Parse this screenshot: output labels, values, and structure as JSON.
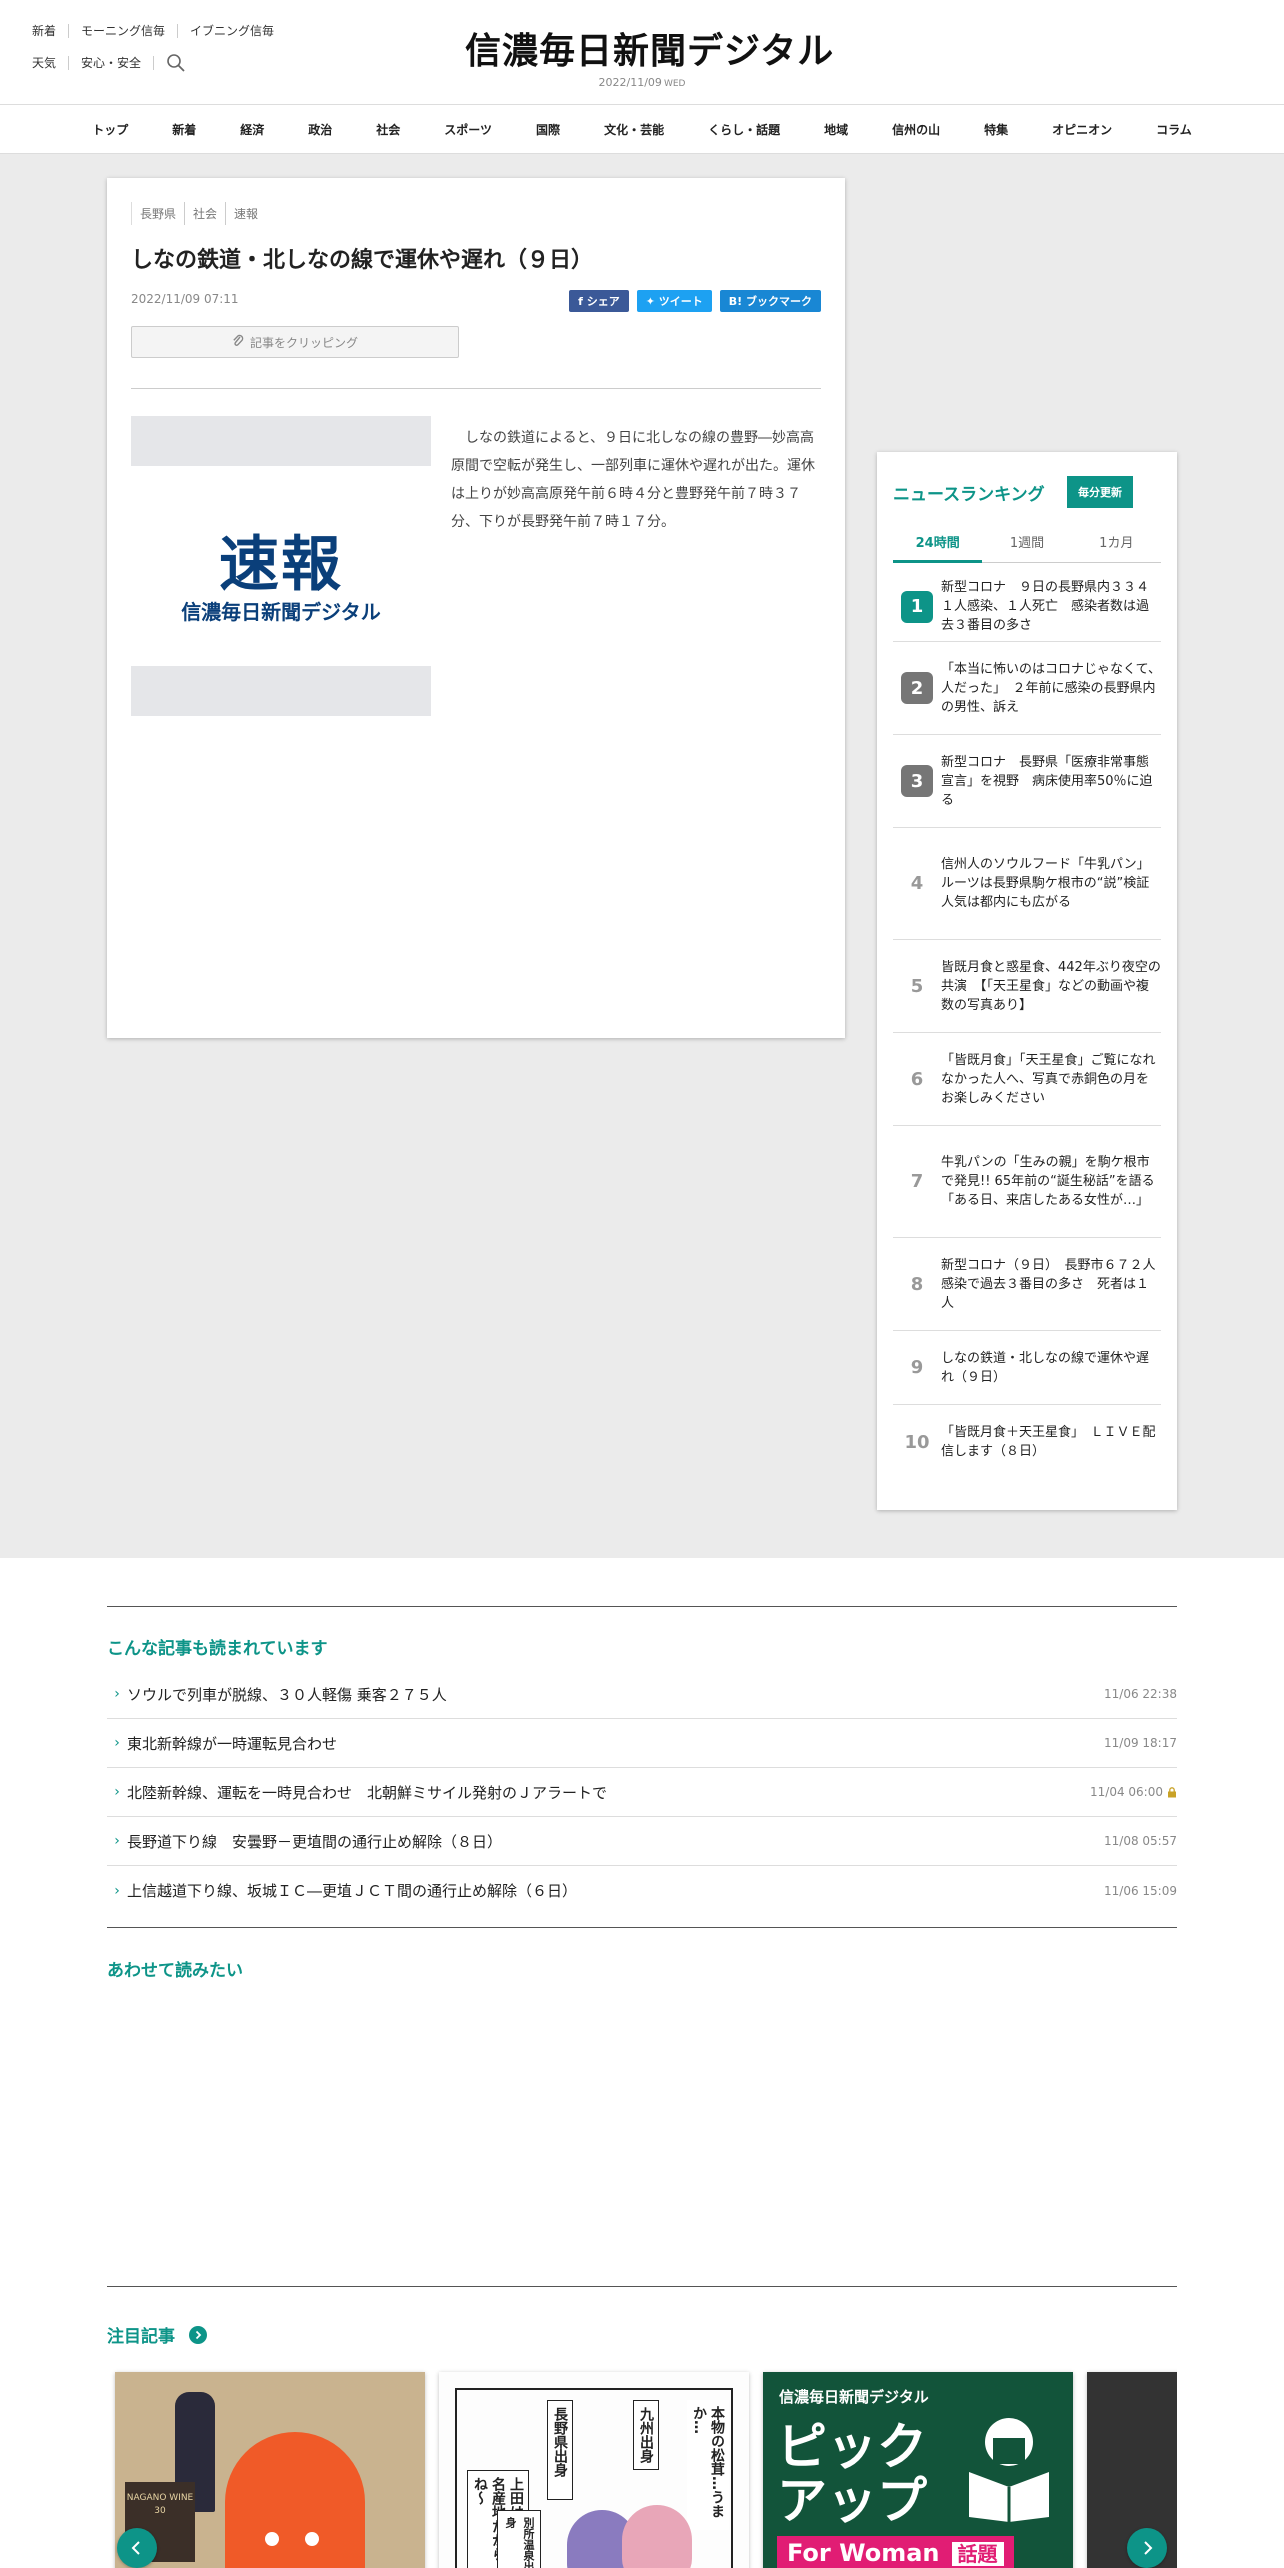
{
  "header": {
    "links_row1": [
      "新着",
      "モーニング信毎",
      "イブニング信毎"
    ],
    "links_row2": [
      "天気",
      "安心・安全"
    ],
    "logo": "信濃毎日新聞デジタル",
    "date": "2022/11/09",
    "dow": "WED"
  },
  "nav": [
    "トップ",
    "新着",
    "経済",
    "政治",
    "社会",
    "スポーツ",
    "国際",
    "文化・芸能",
    "くらし・話題",
    "地域",
    "信州の山",
    "特集",
    "オピニオン",
    "コラム"
  ],
  "article": {
    "tags": [
      "長野県",
      "社会",
      "速報"
    ],
    "title": "しなの鉄道・北しなの線で運休や遅れ（９日）",
    "published": "2022/11/09 07:11",
    "share": {
      "facebook": "シェア",
      "twitter": "ツイート",
      "hatena": "ブックマーク"
    },
    "clip_label": "記事をクリッピング",
    "image_big": "速報",
    "image_small": "信濃毎日新聞デジタル",
    "body": "しなの鉄道によると、９日に北しなの線の豊野―妙高高原間で空転が発生し、一部列車に運休や遅れが出た。運休は上りが妙高高原発午前６時４分と豊野発午前７時３７分、下りが長野発午前７時１７分。"
  },
  "ranking": {
    "title": "ニュースランキング",
    "update_label": "毎分更新",
    "tabs": [
      "24時間",
      "1週間",
      "1カ月"
    ],
    "items": [
      {
        "rank": "1",
        "text": "新型コロナ　９日の長野県内３３４１人感染、１人死亡　感染者数は過去３番目の多さ"
      },
      {
        "rank": "2",
        "text": "「本当に怖いのはコロナじゃなくて、人だった」　２年前に感染の長野県内の男性、訴え"
      },
      {
        "rank": "3",
        "text": "新型コロナ　長野県「医療非常事態宣言」を視野　病床使用率50％に迫る"
      },
      {
        "rank": "4",
        "text": "信州人のソウルフード「牛乳パン」　ルーツは長野県駒ケ根市の“説”検証　人気は都内にも広がる"
      },
      {
        "rank": "5",
        "text": "皆既月食と惑星食、442年ぶり夜空の共演　【「天王星食」などの動画や複数の写真あり】"
      },
      {
        "rank": "6",
        "text": "「皆既月食」「天王星食」ご覧になれなかった人へ、写真で赤銅色の月をお楽しみください"
      },
      {
        "rank": "7",
        "text": "牛乳パンの「生みの親」を駒ケ根市で発見!! 65年前の“誕生秘話”を語る「ある日、来店したある女性が…」"
      },
      {
        "rank": "8",
        "text": "新型コロナ（９日）　長野市６７２人感染で過去３番目の多さ　死者は１人"
      },
      {
        "rank": "9",
        "text": "しなの鉄道・北しなの線で運休や遅れ（９日）"
      },
      {
        "rank": "10",
        "text": "「皆既月食＋天王星食」　ＬＩＶＥ配信します（８日）"
      }
    ]
  },
  "related": {
    "title": "こんな記事も読まれています",
    "items": [
      {
        "title": "ソウルで列車が脱線、３０人軽傷 乗客２７５人",
        "date": "11/06 22:38",
        "locked": false
      },
      {
        "title": "東北新幹線が一時運転見合わせ",
        "date": "11/09 18:17",
        "locked": false
      },
      {
        "title": "北陸新幹線、運転を一時見合わせ　北朝鮮ミサイル発射のＪアラートで",
        "date": "11/04 06:00",
        "locked": true
      },
      {
        "title": "長野道下り線　安曇野－更埴間の通行止め解除（８日）",
        "date": "11/08 05:57",
        "locked": false
      },
      {
        "title": "上信越道下り線、坂城ＩＣ―更埴ＪＣＴ間の通行止め解除（６日）",
        "date": "11/06 15:09",
        "locked": false
      }
    ]
  },
  "also_read": {
    "title": "あわせて読みたい"
  },
  "featured": {
    "title": "注目記事",
    "card1": {
      "label": "NAGANO WINE 30"
    },
    "card2": {
      "bubble1": "本物の松茸…うまか…",
      "bubble2": "九州出身",
      "bubble3": "長野県出身",
      "bubble4": "上田は松茸の名産地だからね～",
      "bubble5": "別所温泉出身"
    },
    "card3": {
      "head": "信濃毎日新聞デジタル",
      "big1": "ピック",
      "big2": "アップ",
      "foot": "For Woman",
      "foot_tag": "話題"
    }
  },
  "colors": {
    "accent": "#0d9488",
    "facebook": "#3b5998",
    "twitter": "#1da1f2",
    "hatena": "#1987d4"
  }
}
